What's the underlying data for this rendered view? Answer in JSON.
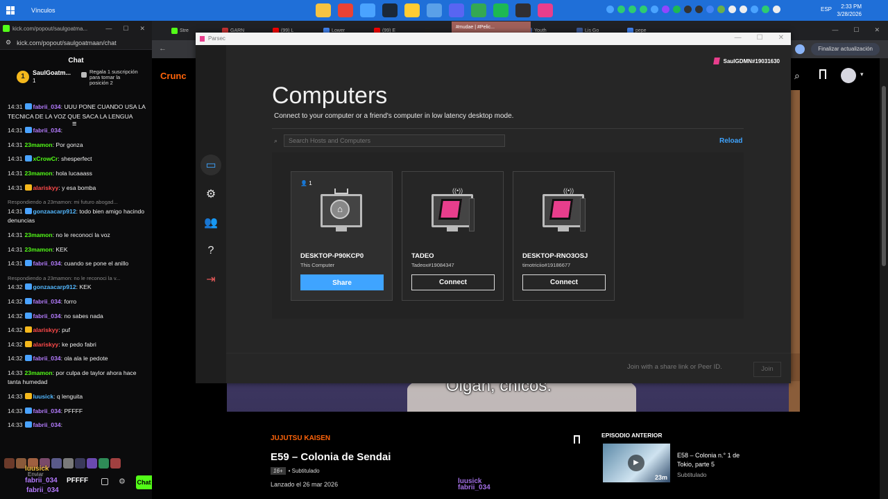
{
  "taskbar": {
    "vinculos": "Vínculos",
    "lang": "ESP",
    "time": "2:33 PM",
    "date": "3/28/2026",
    "apps": [
      {
        "icon": "folder-icon",
        "color": "#f5c342"
      },
      {
        "icon": "chrome-icon",
        "color": "#e94235"
      },
      {
        "icon": "pen-icon",
        "color": "#4aa3ff"
      },
      {
        "icon": "steam-icon",
        "color": "#1b2838"
      },
      {
        "icon": "store-icon",
        "color": "#ffcc33"
      },
      {
        "icon": "photos-icon",
        "color": "#5aa0e8"
      },
      {
        "icon": "discord-icon",
        "color": "#5865f2"
      },
      {
        "icon": "chrome-profile-icon",
        "color": "#34a853"
      },
      {
        "icon": "spotify-icon",
        "color": "#1db954"
      },
      {
        "icon": "obs-icon",
        "color": "#302e31"
      },
      {
        "icon": "parsec-icon",
        "color": "#e83e8c"
      }
    ],
    "tray_colors": [
      "#4aa3ff",
      "#2ecc71",
      "#2ecc71",
      "#2ecc71",
      "#4aa3ff",
      "#9146ff",
      "#1db954",
      "#333",
      "#333",
      "#4285f4",
      "#6ab04c",
      "#eee",
      "#eee",
      "#4aa3ff",
      "#2ecc71",
      "#eee"
    ]
  },
  "kick": {
    "tab_title": "kick.com/popout/saulgoatma...",
    "url": "kick.com/popout/saulgoatmaan/chat",
    "chat_title": "Chat",
    "pinned_user": "SaulGoatm...",
    "pinned_count": "1",
    "pinned_gift": "Regala 1 suscripción para tomar la posición 2",
    "send_label": "Enviar",
    "chat_button": "Chat",
    "overlay_user_1": "luusick",
    "overlay_user_2": "fabrii_034",
    "overlay_user_3": "fabrii_034",
    "overlay_text": "PFFFF"
  },
  "chat": [
    {
      "time": "14:31",
      "user": "fabrii_034",
      "color": "#b57cff",
      "badge": "#4aa3ff",
      "text": "UUU PONE CUANDO USA LA TECNICA DE LA VOZ QUE SACA LA LENGUA"
    },
    {
      "time": "14:31",
      "user": "fabrii_034",
      "color": "#b57cff",
      "badge": "#4aa3ff",
      "text": ""
    },
    {
      "time": "14:31",
      "user": "23mamon",
      "color": "#53fc18",
      "badge": "",
      "text": "Por gonza"
    },
    {
      "time": "14:31",
      "user": "xCrowCr",
      "color": "#53fc18",
      "badge": "#4aa3ff",
      "text": "shesperfect"
    },
    {
      "time": "14:31",
      "user": "23mamon",
      "color": "#53fc18",
      "badge": "",
      "text": "hola lucaaass"
    },
    {
      "time": "14:31",
      "user": "alariskyy",
      "color": "#ff4a4a",
      "badge": "#f5b81c",
      "text": "y esa bomba"
    },
    {
      "reply": "Respondiendo a 23mamon: mi futuro abogad..."
    },
    {
      "time": "14:31",
      "user": "gonzaacarp912",
      "color": "#53b8ff",
      "badge": "#4aa3ff",
      "text": "todo bien amigo hacindo denuncias"
    },
    {
      "time": "14:31",
      "user": "23mamon",
      "color": "#53fc18",
      "badge": "",
      "text": "no le reconoci la voz"
    },
    {
      "time": "14:31",
      "user": "23mamon",
      "color": "#53fc18",
      "badge": "",
      "text": "KEK"
    },
    {
      "time": "14:31",
      "user": "fabrii_034",
      "color": "#b57cff",
      "badge": "#4aa3ff",
      "text": "cuando se pone el anillo"
    },
    {
      "reply": "Respondiendo a 23mamon: no le reconoci la v..."
    },
    {
      "time": "14:32",
      "user": "gonzaacarp912",
      "color": "#53b8ff",
      "badge": "#4aa3ff",
      "text": "KEK"
    },
    {
      "time": "14:32",
      "user": "fabrii_034",
      "color": "#b57cff",
      "badge": "#4aa3ff",
      "text": "forro"
    },
    {
      "time": "14:32",
      "user": "fabrii_034",
      "color": "#b57cff",
      "badge": "#4aa3ff",
      "text": "no sabes nada"
    },
    {
      "time": "14:32",
      "user": "alariskyy",
      "color": "#ff4a4a",
      "badge": "#f5b81c",
      "text": "puf"
    },
    {
      "time": "14:32",
      "user": "alariskyy",
      "color": "#ff4a4a",
      "badge": "#f5b81c",
      "text": "ke pedo fabri"
    },
    {
      "time": "14:32",
      "user": "fabrii_034",
      "color": "#b57cff",
      "badge": "#4aa3ff",
      "text": "ola ala le pedote"
    },
    {
      "time": "14:33",
      "user": "23mamon",
      "color": "#53fc18",
      "badge": "",
      "text": "por culpa de taylor ahora hace tanta humedad"
    },
    {
      "time": "14:33",
      "user": "luusick",
      "color": "#53b8ff",
      "badge": "#f5b81c",
      "text": "q lenguita"
    },
    {
      "time": "14:33",
      "user": "fabrii_034",
      "color": "#b57cff",
      "badge": "#4aa3ff",
      "text": "PFFFF"
    },
    {
      "time": "14:33",
      "user": "fabrii_034",
      "color": "#b57cff",
      "badge": "#4aa3ff",
      "text": ""
    }
  ],
  "browser": {
    "update_label": "Finalizar actualización",
    "logo": "Crunc",
    "show": "JUJUTSU KAISEN",
    "episode": "E59 – Colonia de Sendai",
    "rating": "16+",
    "subtitled": "• Subtitulado",
    "released": "Lanzado el 26 mar 2026",
    "prev_label": "EPISODIO ANTERIOR",
    "prev_title": "E58 – Colonia n.° 1 de Tokio, parte 5",
    "prev_duration": "23m",
    "prev_sub": "Subtitulado",
    "subtitle_text": "Oigan, chicos.",
    "tabs": [
      "Stre",
      "GARN",
      "(99) L",
      "Lower",
      "(99) E",
      "",
      "Tenga",
      "Youth",
      "Lis Go",
      "pepe"
    ]
  },
  "discord_thumb": {
    "title": "#mudae | #Pelic..."
  },
  "parsec": {
    "window_title": "Parsec",
    "user": "SaulGDMN#19031630",
    "title": "Computers",
    "subtitle": "Connect to your computer or a friend's computer in low latency desktop mode.",
    "search_placeholder": "Search Hosts and Computers",
    "reload": "Reload",
    "join_placeholder": "Join with a share link or Peer ID.",
    "join_button": "Join",
    "hosts": [
      {
        "name": "DESKTOP-P90KCP0",
        "sub": "This Computer",
        "button": "Share",
        "users": "1"
      },
      {
        "name": "TADEO",
        "sub": "Tadeox#19084347",
        "button": "Connect"
      },
      {
        "name": "DESKTOP-RNO3OSJ",
        "sub": "timotriciio#19186677",
        "button": "Connect"
      }
    ]
  }
}
